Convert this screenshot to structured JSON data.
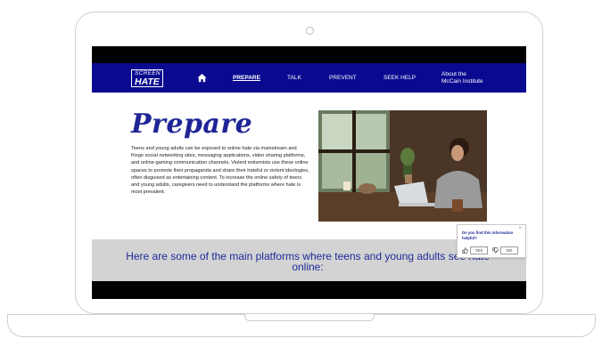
{
  "nav": {
    "logo_line1": "SCREEN",
    "logo_line2": "HATE",
    "items": [
      {
        "label": "PREPARE",
        "active": true
      },
      {
        "label": "TALK",
        "active": false
      },
      {
        "label": "PREVENT",
        "active": false
      },
      {
        "label": "SEEK HELP",
        "active": false
      }
    ],
    "about_line1": "About the",
    "about_line2": "McCain Institute"
  },
  "hero": {
    "title": "Prepare",
    "body": "Teens and young adults can be exposed to online hate via mainstream and fringe social networking sites, messaging applications, video sharing platforms, and online-gaming communication channels. Violent extremists use these online spaces to promote their propaganda and share their hateful or violent ideologies, often disguised as entertaining content. To increase the online safety of teens and young adults, caregivers need to understand the platforms where hate is most prevalent."
  },
  "band": {
    "heading": "Here are some of the main platforms where teens and young adults see hate online:"
  },
  "feedback": {
    "question": "Do you find this information helpful?",
    "yes_label": "YES",
    "no_label": "NO",
    "close": "×"
  },
  "colors": {
    "nav_bg": "#0a0a91",
    "title": "#1f2596",
    "band_bg": "#d3d3d3",
    "band_text": "#1e2a9a"
  },
  "icons": [
    "home-icon",
    "thumbs-up-icon",
    "thumbs-down-icon",
    "close-icon"
  ]
}
